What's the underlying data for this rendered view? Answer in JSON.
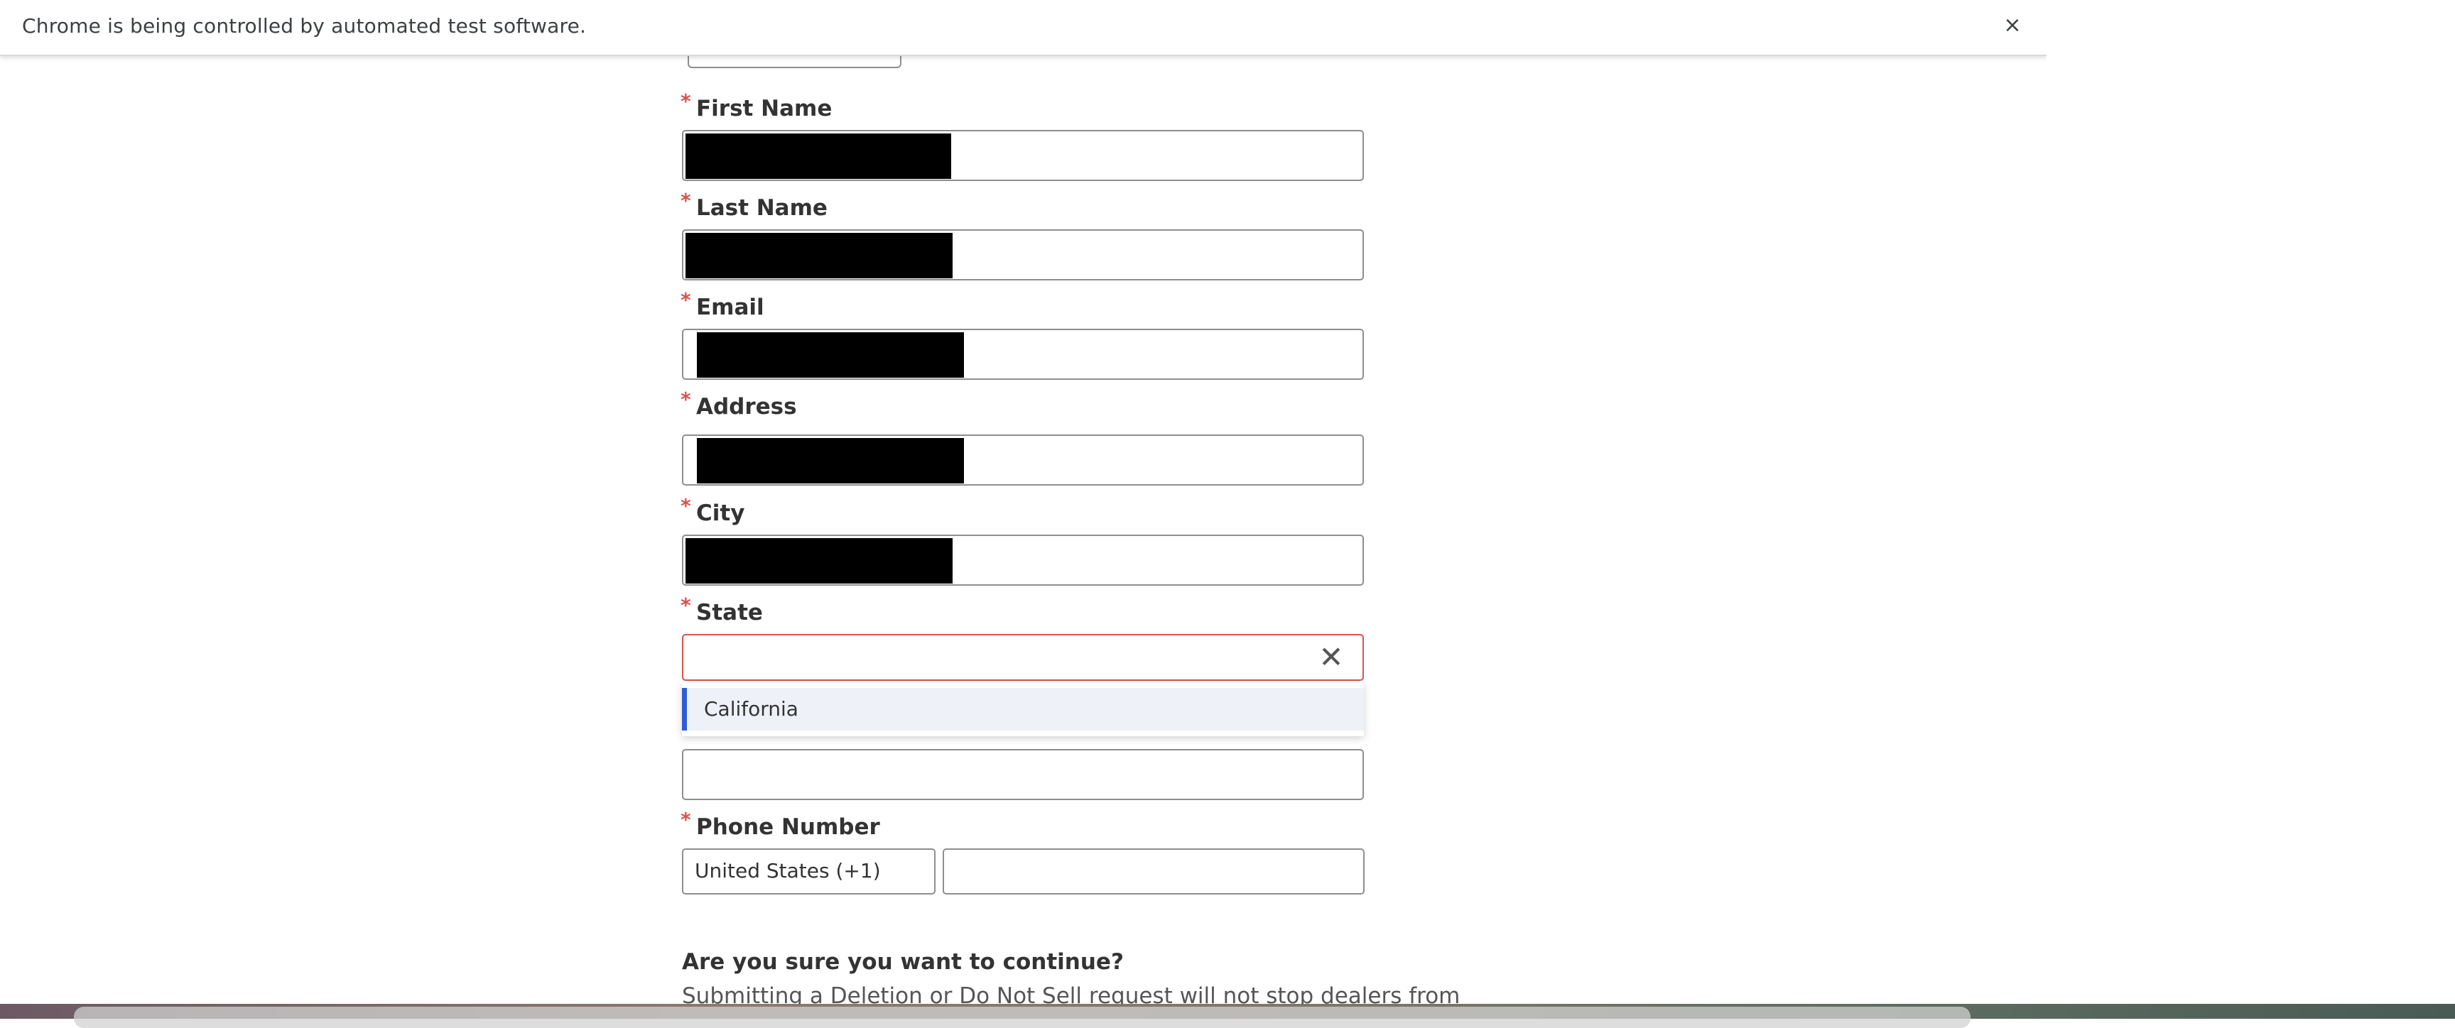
{
  "infobar": {
    "message": "Chrome is being controlled by automated test software.",
    "close_label": "×"
  },
  "form": {
    "first_name": {
      "label": "First Name",
      "required_mark": "*"
    },
    "last_name": {
      "label": "Last Name",
      "required_mark": "*"
    },
    "email": {
      "label": "Email",
      "required_mark": "*"
    },
    "address": {
      "label": "Address",
      "required_mark": "*"
    },
    "city": {
      "label": "City",
      "required_mark": "*"
    },
    "state": {
      "label": "State",
      "required_mark": "*",
      "value": "",
      "clear_label": "✕",
      "options": [
        "California"
      ]
    },
    "zip": {
      "value": ""
    },
    "phone": {
      "label": "Phone Number",
      "required_mark": "*",
      "country_code": "United States (+1)",
      "value": ""
    }
  },
  "confirm": {
    "heading": "Are you sure you want to continue?",
    "body": "Submitting a Deletion or Do Not Sell request will not stop dealers from"
  },
  "colors": {
    "required": "#d9534f",
    "error_border": "#d9534f",
    "option_highlight": "#2f5bd3",
    "redaction": "#000000"
  }
}
